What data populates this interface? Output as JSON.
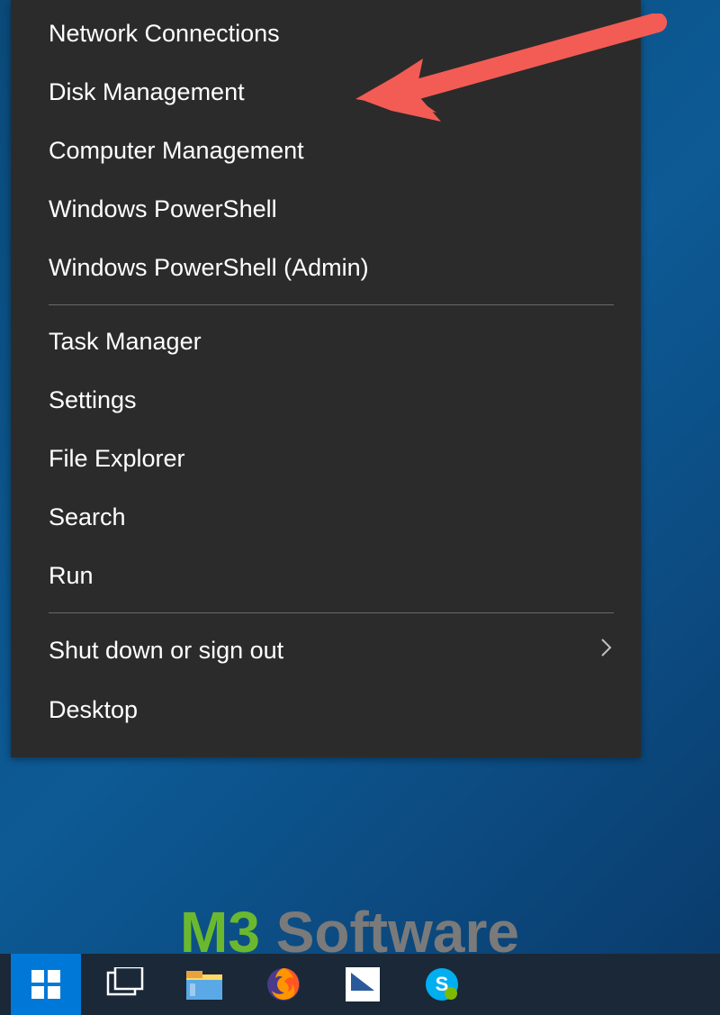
{
  "menu": {
    "group1": [
      {
        "label": "Network Connections",
        "name": "network-connections"
      },
      {
        "label": "Disk Management",
        "name": "disk-management"
      },
      {
        "label": "Computer Management",
        "name": "computer-management"
      },
      {
        "label": "Windows PowerShell",
        "name": "windows-powershell"
      },
      {
        "label": "Windows PowerShell (Admin)",
        "name": "windows-powershell-admin"
      }
    ],
    "group2": [
      {
        "label": "Task Manager",
        "name": "task-manager"
      },
      {
        "label": "Settings",
        "name": "settings"
      },
      {
        "label": "File Explorer",
        "name": "file-explorer"
      },
      {
        "label": "Search",
        "name": "search"
      },
      {
        "label": "Run",
        "name": "run"
      }
    ],
    "group3": [
      {
        "label": "Shut down or sign out",
        "name": "shut-down-or-sign-out",
        "hasSubmenu": true
      },
      {
        "label": "Desktop",
        "name": "desktop"
      }
    ]
  },
  "watermark": {
    "m3": "M3",
    "software": " Software"
  }
}
